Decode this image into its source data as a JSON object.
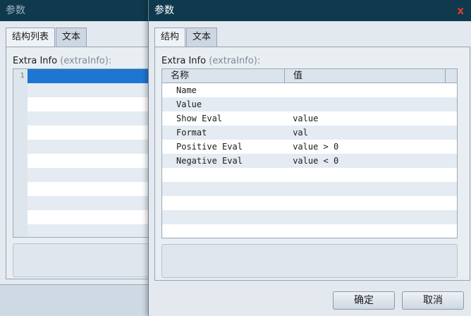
{
  "background_dialog": {
    "title": "参数",
    "tabs": [
      "结构列表",
      "文本"
    ],
    "field_label": "Extra Info",
    "field_hint": "(extraInfo):",
    "line_number": "1"
  },
  "dialog": {
    "title": "参数",
    "close_glyph": "x",
    "tabs": [
      "结构",
      "文本"
    ],
    "field_label": "Extra Info",
    "field_hint": "(extraInfo):",
    "grid": {
      "headers": [
        "名称",
        "值"
      ],
      "rows": [
        {
          "name": "Name",
          "value": ""
        },
        {
          "name": "Value",
          "value": ""
        },
        {
          "name": "Show Eval",
          "value": "value"
        },
        {
          "name": "Format",
          "value": "val"
        },
        {
          "name": "Positive Eval",
          "value": "value > 0"
        },
        {
          "name": "Negative Eval",
          "value": "value < 0"
        }
      ]
    },
    "buttons": {
      "ok": "确定",
      "cancel": "取消"
    }
  },
  "colors": {
    "titlebar": "#0f3a4e",
    "selection": "#1f76d2",
    "close": "#e03a2f"
  }
}
